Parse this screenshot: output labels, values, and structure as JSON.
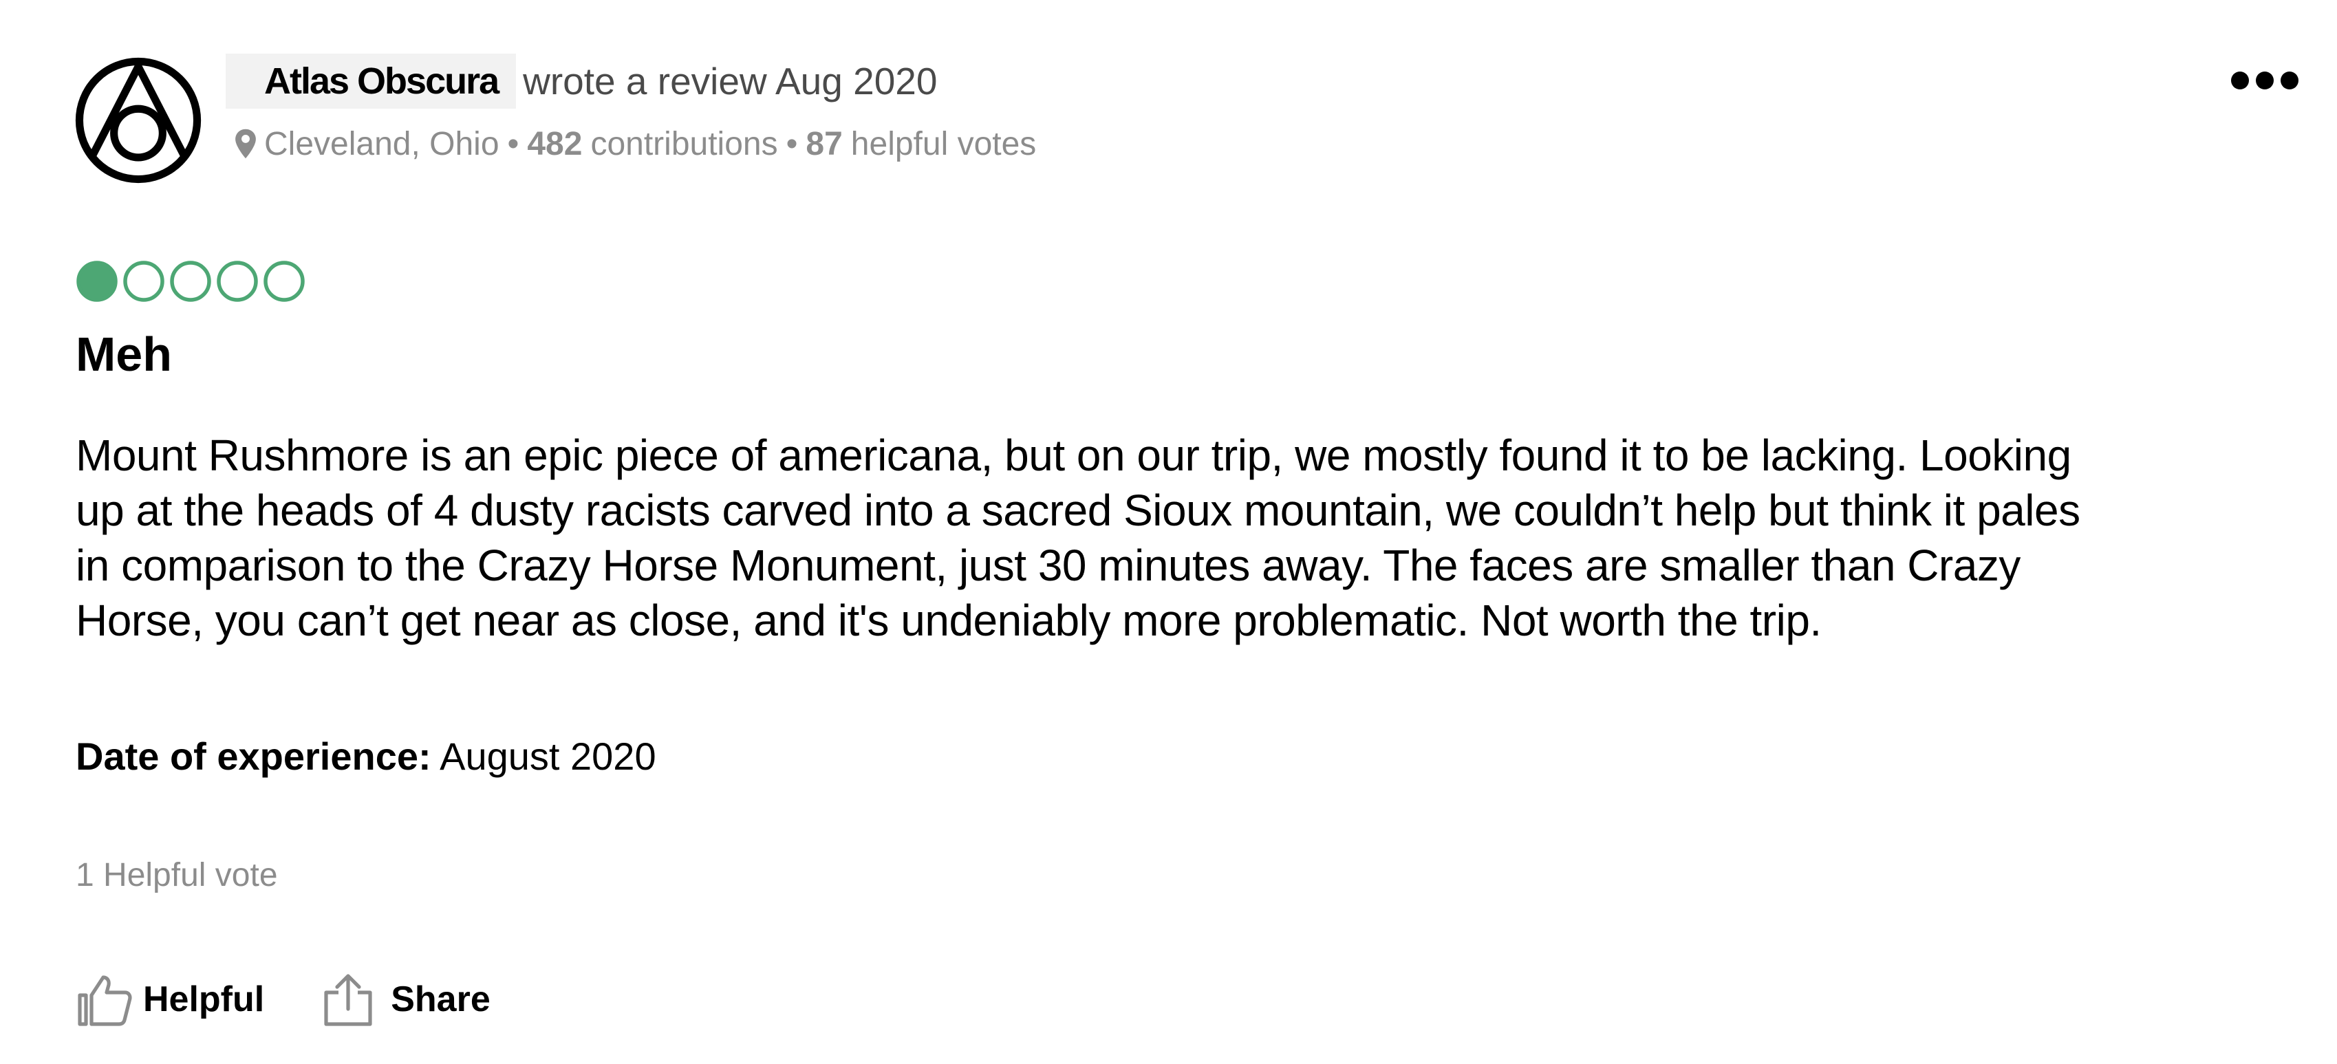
{
  "author": {
    "name": "Atlas Obscura",
    "review_meta": "wrote a review Aug 2020",
    "location": "Cleveland, Ohio",
    "separator": "•",
    "contributions_count": "482",
    "contributions_label": "contributions",
    "helpful_votes_count": "87",
    "helpful_votes_label": "helpful votes"
  },
  "review": {
    "rating": 1,
    "rating_max": 5,
    "rating_color": "#4da774",
    "title": "Meh",
    "body_lines": [
      "Mount Rushmore is an epic piece of americana, but on our trip, we mostly found it to be lacking. Looking",
      "up at the heads of 4 dusty racists carved into a sacred Sioux mountain, we couldn’t help but think it pales",
      "in comparison to the Crazy Horse Monument, just 30 minutes away. The faces are smaller than Crazy",
      "Horse, you can’t get near as close, and it's undeniably more problematic. Not worth the trip."
    ],
    "date_label": "Date of experience:",
    "date_value": "August 2020",
    "helpful_count_text": "1 Helpful vote"
  },
  "actions": {
    "helpful_label": "Helpful",
    "share_label": "Share"
  },
  "icons": {
    "avatar": "atlas-obscura-logo",
    "location": "map-pin-icon",
    "more": "more-options-icon",
    "helpful": "thumbs-up-icon",
    "share": "share-icon"
  }
}
